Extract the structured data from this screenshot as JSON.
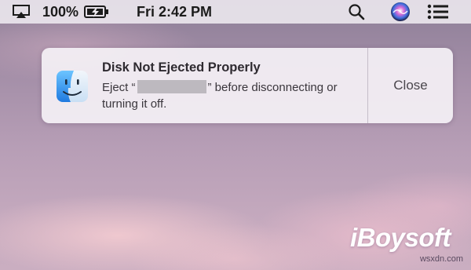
{
  "menubar": {
    "airplay_icon": "airplay-icon",
    "battery_percent": "100%",
    "battery_icon": "battery-charging-icon",
    "clock": "Fri 2:42 PM",
    "spotlight_icon": "spotlight-search-icon",
    "siri_icon": "siri-icon",
    "notification_center_icon": "notification-center-icon"
  },
  "notification": {
    "app_icon": "finder-icon",
    "title": "Disk Not Ejected Properly",
    "body_prefix": "Eject “",
    "body_suffix": "” before disconnecting or turning it off.",
    "close_label": "Close"
  },
  "watermark": {
    "brand": "iBoysoft",
    "site": "wsxdn.com"
  },
  "colors": {
    "menubar_bg": "#ECE8EE",
    "notification_bg": "#F4F0F5",
    "redaction": "#BDB9BF",
    "finder_blue": "#3C8CE8"
  }
}
